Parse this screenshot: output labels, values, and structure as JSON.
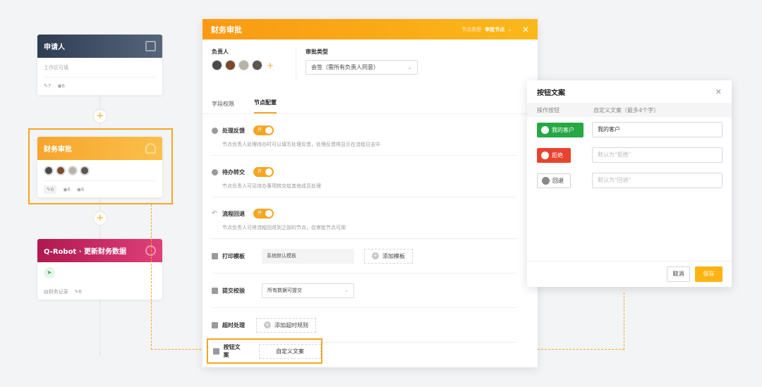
{
  "colors": {
    "accent": "#f5a623",
    "green": "#27a844",
    "red": "#e8432f"
  },
  "flow": {
    "applicant": {
      "title": "申请人",
      "subtitle": "工作区可填",
      "edit_count": "7",
      "view_count": "6"
    },
    "finance": {
      "title": "财务审批",
      "edit_count": "6",
      "view_count": "6",
      "view_count2": "6"
    },
    "robot": {
      "title": "Q-Robot · 更新财务数据",
      "record_label": "财务记录",
      "edit_count": "6"
    },
    "plus": "+"
  },
  "panel": {
    "title": "财务审批",
    "node_type_label": "节点类型",
    "node_type_value": "审批节点",
    "close": "✕",
    "responsible_label": "负责人",
    "approval_type_label": "审批类型",
    "approval_type_value": "会签（需所有负责人同意）",
    "add": "+",
    "tabs": [
      "字段权限",
      "节点配置"
    ],
    "settings": {
      "feedback": {
        "title": "处理反馈",
        "toggle": "开",
        "desc": "节点负责人处理待办时可以填写处理反馈，处理反馈将显示在流程日志中"
      },
      "transfer": {
        "title": "待办转交",
        "toggle": "开",
        "desc": "节点负责人可见待办事项转交给其他成员处理"
      },
      "rollback": {
        "title": "流程回退",
        "toggle": "开",
        "desc": "节点负责人可将流程回退到之前的节点，仅审批节点可用"
      },
      "print": {
        "title": "打印模板",
        "value": "系统默认模板",
        "add_button": "添加模板"
      },
      "submit": {
        "title": "提交校验",
        "value": "所有数据可提交"
      },
      "timeout": {
        "title": "超时处理",
        "add_button": "添加超时规则"
      },
      "button_text": {
        "title": "按钮文案",
        "button": "自定义文案"
      }
    }
  },
  "dialog": {
    "title": "按钮文案",
    "close": "✕",
    "col_action": "操作按钮",
    "col_custom": "自定义文案（最多4个字）",
    "rows": [
      {
        "button": "我的客户",
        "value": "我的客户"
      },
      {
        "button": "拒绝",
        "placeholder": "默认为\"拒绝\""
      },
      {
        "button": "回退",
        "placeholder": "默认为\"回退\""
      }
    ],
    "cancel": "取消",
    "save": "保存"
  }
}
